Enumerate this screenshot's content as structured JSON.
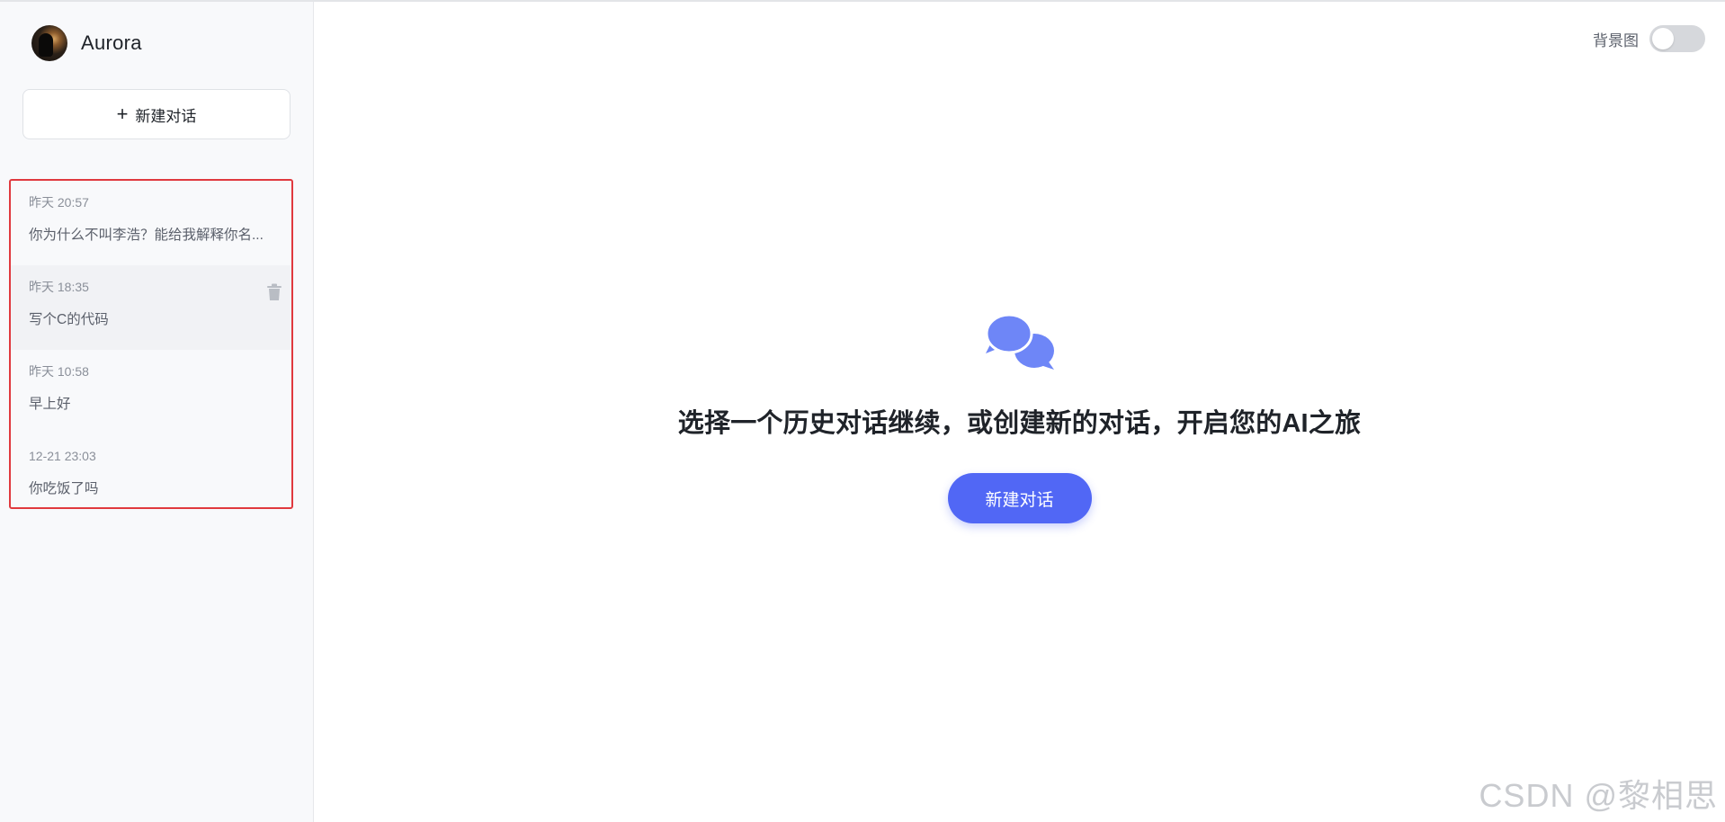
{
  "sidebar": {
    "username": "Aurora",
    "new_chat_label": "新建对话",
    "history": [
      {
        "time": "昨天 20:57",
        "title": "你为什么不叫李浩？能给我解释你名..."
      },
      {
        "time": "昨天 18:35",
        "title": "写个C的代码"
      },
      {
        "time": "昨天 10:58",
        "title": "早上好"
      },
      {
        "time": "12-21 23:03",
        "title": "你吃饭了吗"
      }
    ]
  },
  "header": {
    "background_label": "背景图",
    "background_enabled": false
  },
  "main": {
    "prompt": "选择一个历史对话继续，或创建新的对话，开启您的AI之旅",
    "new_chat_label": "新建对话"
  },
  "watermark": "CSDN @黎相思",
  "colors": {
    "accent": "#5167f5",
    "chat_icon": "#6e86f7",
    "highlight_border": "#e0393e",
    "sidebar_bg": "#f8f9fb"
  }
}
